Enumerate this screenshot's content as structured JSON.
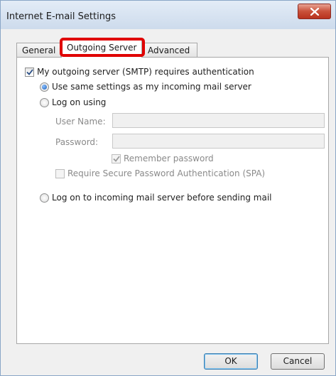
{
  "window": {
    "title": "Internet E-mail Settings"
  },
  "tabs": [
    {
      "label": "General"
    },
    {
      "label": "Outgoing Server"
    },
    {
      "label": "Advanced"
    }
  ],
  "auth": {
    "requires_auth_label": "My outgoing server (SMTP) requires authentication",
    "requires_auth_checked": true,
    "use_same_label": "Use same settings as my incoming mail server",
    "use_same_selected": true,
    "log_on_using_label": "Log on using",
    "username_label": "User Name:",
    "username_value": "",
    "password_label": "Password:",
    "password_value": "",
    "remember_password_label": "Remember password",
    "remember_password_checked": true,
    "spa_label": "Require Secure Password Authentication (SPA)",
    "spa_checked": false,
    "log_on_incoming_label": "Log on to incoming mail server before sending mail"
  },
  "buttons": {
    "ok": "OK",
    "cancel": "Cancel"
  },
  "colors": {
    "highlight": "#e00000",
    "close_button": "#c9503a"
  }
}
